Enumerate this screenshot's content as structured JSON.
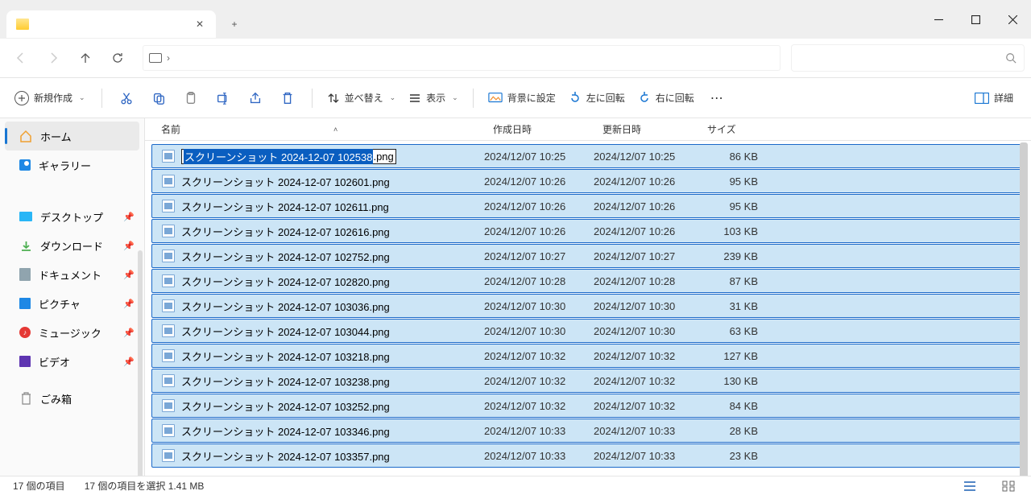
{
  "tab": {
    "title": "",
    "close": "✕",
    "new": "+"
  },
  "toolbar": {
    "new_label": "新規作成",
    "sort_label": "並べ替え",
    "view_label": "表示",
    "bg_label": "背景に設定",
    "rotate_left": "左に回転",
    "rotate_right": "右に回転",
    "details": "詳細"
  },
  "sidebar": {
    "items": [
      {
        "label": "ホーム",
        "icon": "home",
        "active": true
      },
      {
        "label": "ギャラリー",
        "icon": "gallery"
      }
    ],
    "pinned": [
      {
        "label": "デスクトップ",
        "icon": "desktop"
      },
      {
        "label": "ダウンロード",
        "icon": "download"
      },
      {
        "label": "ドキュメント",
        "icon": "doc"
      },
      {
        "label": "ピクチャ",
        "icon": "pic"
      },
      {
        "label": "ミュージック",
        "icon": "music"
      },
      {
        "label": "ビデオ",
        "icon": "video"
      }
    ],
    "trash": {
      "label": "ごみ箱"
    }
  },
  "columns": {
    "name": "名前",
    "created": "作成日時",
    "modified": "更新日時",
    "size": "サイズ"
  },
  "rename": {
    "selected": "スクリーンショット 2024-12-07 102538",
    "ext": ".png"
  },
  "files": [
    {
      "name": "スクリーンショット 2024-12-07 102538.png",
      "created": "2024/12/07 10:25",
      "modified": "2024/12/07 10:25",
      "size": "86 KB",
      "renaming": true
    },
    {
      "name": "スクリーンショット 2024-12-07 102601.png",
      "created": "2024/12/07 10:26",
      "modified": "2024/12/07 10:26",
      "size": "95 KB"
    },
    {
      "name": "スクリーンショット 2024-12-07 102611.png",
      "created": "2024/12/07 10:26",
      "modified": "2024/12/07 10:26",
      "size": "95 KB"
    },
    {
      "name": "スクリーンショット 2024-12-07 102616.png",
      "created": "2024/12/07 10:26",
      "modified": "2024/12/07 10:26",
      "size": "103 KB"
    },
    {
      "name": "スクリーンショット 2024-12-07 102752.png",
      "created": "2024/12/07 10:27",
      "modified": "2024/12/07 10:27",
      "size": "239 KB"
    },
    {
      "name": "スクリーンショット 2024-12-07 102820.png",
      "created": "2024/12/07 10:28",
      "modified": "2024/12/07 10:28",
      "size": "87 KB"
    },
    {
      "name": "スクリーンショット 2024-12-07 103036.png",
      "created": "2024/12/07 10:30",
      "modified": "2024/12/07 10:30",
      "size": "31 KB"
    },
    {
      "name": "スクリーンショット 2024-12-07 103044.png",
      "created": "2024/12/07 10:30",
      "modified": "2024/12/07 10:30",
      "size": "63 KB"
    },
    {
      "name": "スクリーンショット 2024-12-07 103218.png",
      "created": "2024/12/07 10:32",
      "modified": "2024/12/07 10:32",
      "size": "127 KB"
    },
    {
      "name": "スクリーンショット 2024-12-07 103238.png",
      "created": "2024/12/07 10:32",
      "modified": "2024/12/07 10:32",
      "size": "130 KB"
    },
    {
      "name": "スクリーンショット 2024-12-07 103252.png",
      "created": "2024/12/07 10:32",
      "modified": "2024/12/07 10:32",
      "size": "84 KB"
    },
    {
      "name": "スクリーンショット 2024-12-07 103346.png",
      "created": "2024/12/07 10:33",
      "modified": "2024/12/07 10:33",
      "size": "28 KB"
    },
    {
      "name": "スクリーンショット 2024-12-07 103357.png",
      "created": "2024/12/07 10:33",
      "modified": "2024/12/07 10:33",
      "size": "23 KB"
    }
  ],
  "status": {
    "total": "17 個の項目",
    "selected": "17 個の項目を選択  1.41 MB"
  }
}
